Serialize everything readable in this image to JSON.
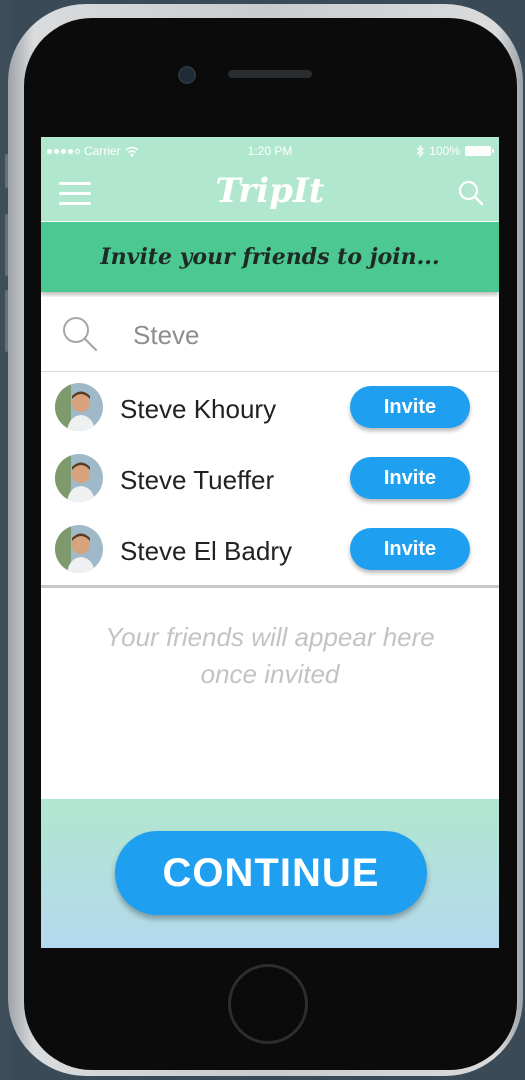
{
  "status_bar": {
    "carrier": "Carrier",
    "time": "1:20 PM",
    "battery": "100%"
  },
  "nav": {
    "app_title": "TripIt"
  },
  "banner": {
    "text": "Invite your friends to join..."
  },
  "search": {
    "value": "Steve"
  },
  "friends": [
    {
      "name": "Steve Khoury",
      "action_label": "Invite"
    },
    {
      "name": "Steve Tueffer",
      "action_label": "Invite"
    },
    {
      "name": "Steve El Badry",
      "action_label": "Invite"
    }
  ],
  "empty_state": {
    "line1": "Your friends will appear here",
    "line2": "once invited"
  },
  "footer": {
    "continue_label": "CONTINUE"
  },
  "colors": {
    "mint": "#b2e7cf",
    "green_banner": "#4cc893",
    "accent_blue": "#1f9ff0",
    "placeholder_gray": "#c3c3c3"
  },
  "icons": [
    "camera-icon",
    "menu-icon",
    "search-icon",
    "wifi-icon",
    "bluetooth-icon",
    "battery-icon",
    "avatar-icon"
  ]
}
